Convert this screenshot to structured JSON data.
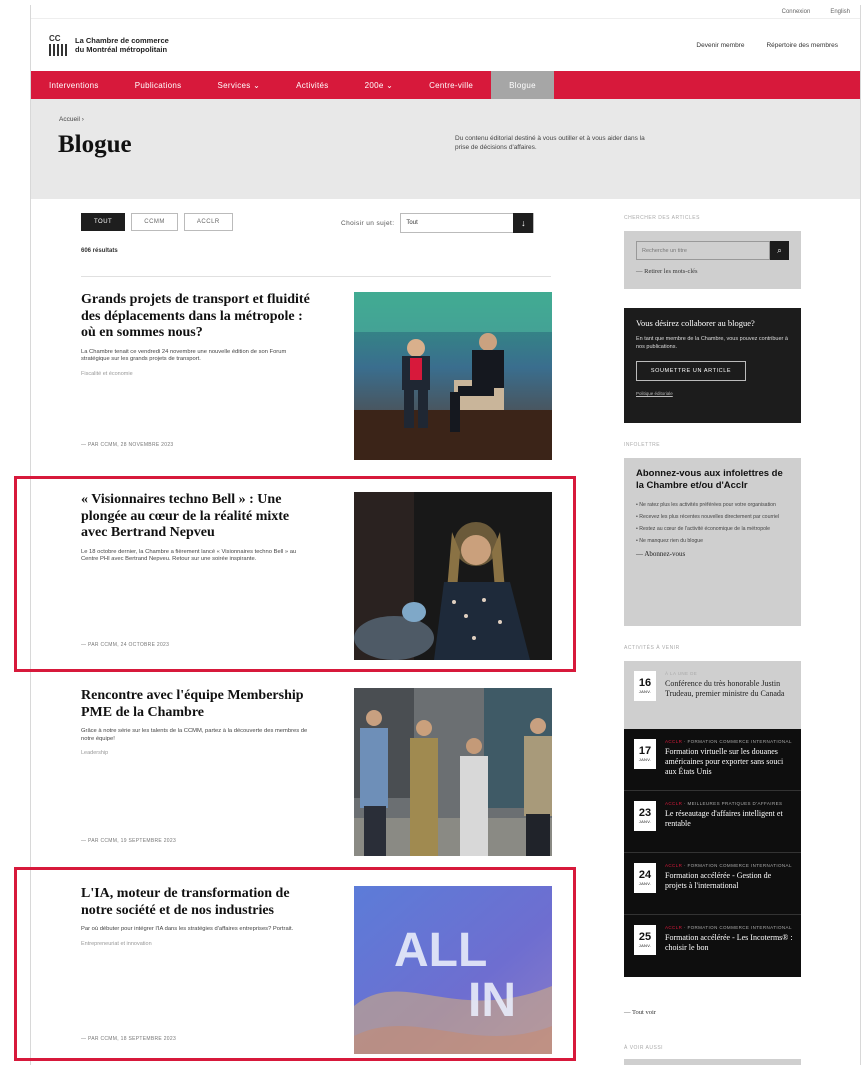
{
  "topbar": {
    "login": "Connexion",
    "lang": "English"
  },
  "header": {
    "logo_cc": "CC",
    "logo_line1": "La Chambre de commerce",
    "logo_line2": "du Montréal métropolitain",
    "link_member": "Devenir membre",
    "link_directory": "Répertoire des membres"
  },
  "nav": [
    {
      "label": "Interventions"
    },
    {
      "label": "Publications"
    },
    {
      "label": "Services ⌄"
    },
    {
      "label": "Activités"
    },
    {
      "label": "200e ⌄"
    },
    {
      "label": "Centre-ville"
    },
    {
      "label": "Blogue"
    }
  ],
  "page": {
    "breadcrumb": "Accueil  ›",
    "title": "Blogue",
    "description": "Du contenu éditorial destiné à vous outiller et à vous aider dans la prise de décisions d'affaires."
  },
  "filters": {
    "all": "TOUT",
    "ccmm": "CCMM",
    "acclr": "ACCLR"
  },
  "topic": {
    "label": "Choisir un sujet:",
    "value": "Tout",
    "arrow": "↓"
  },
  "results": "606 résultats",
  "articles": [
    {
      "title": "Grands projets de transport et fluidité des déplacements dans la métropole : où en sommes nous?",
      "excerpt": "La Chambre tenait ce vendredi 24 novembre une nouvelle édition de son Forum stratégique sur les grands projets de transport.",
      "tag": "Fiscalité et économie",
      "byline": "— PAR CCMM, 28 NOVEMBRE 2023"
    },
    {
      "title": "« Visionnaires techno Bell » : Une plongée au cœur de la réalité mixte avec Bertrand Nepveu",
      "excerpt": "Le 18 octobre dernier, la Chambre a fièrement lancé « Visionnaires techno Bell » au Centre PHI avec Bertrand Nepveu. Retour sur une soirée inspirante.",
      "tag": "",
      "byline": "— PAR CCMM, 24 OCTOBRE 2023"
    },
    {
      "title": "Rencontre avec l'équipe Membership PME de la Chambre",
      "excerpt": "Grâce à notre série sur les talents de la CCMM, partez à la découverte des membres de notre équipe!",
      "tag": "Leadership",
      "byline": "— PAR CCMM, 19 SEPTEMBRE 2023"
    },
    {
      "title": "L'IA, moteur de transformation de notre société et de nos industries",
      "excerpt": "Par où débuter pour intégrer l'IA dans les stratégies d'affaires entreprises? Portrait.",
      "tag": "Entrepreneuriat et innovation",
      "byline": "— PAR CCMM, 18 SEPTEMBRE 2023",
      "image_text_1": "ALL",
      "image_text_2": "IN"
    }
  ],
  "sidebar": {
    "search_label": "CHERCHER DES ARTICLES",
    "search_placeholder": "Recherche un titre",
    "search_reset": "Retirer les mots-clés",
    "collab_title": "Vous désirez collaborer au blogue?",
    "collab_text": "En tant que membre de la Chambre, vous pouvez contribuer à nos publications.",
    "collab_button": "SOUMETTRE UN ARTICLE",
    "collab_foot": "Politique éditoriale",
    "news_label": "INFOLETTRE",
    "news_title": "Abonnez-vous aux infolettres de la Chambre et/ou d'Acclr",
    "news_items": [
      "• Ne ratez plus les activités préférées pour votre organisation",
      "• Recevez les plus récentes nouvelles directement par courriel",
      "• Restez au cœur de l'activité économique de la métropole",
      "• Ne manquez rien du blogue"
    ],
    "news_link": "Abonnez-vous",
    "events_label": "ACTIVITÉS À VENIR",
    "events": [
      {
        "day": "16",
        "month": "JANV.",
        "cat_red": "",
        "cat": "À LA UNE DE",
        "title": "Conférence du très honorable Justin Trudeau, premier ministre du Canada"
      },
      {
        "day": "17",
        "month": "JANV.",
        "cat_red": "ACCLR",
        "cat": " · FORMATION COMMERCE INTERNATIONAL",
        "title": "Formation virtuelle sur les douanes américaines pour exporter sans souci aux États Unis"
      },
      {
        "day": "23",
        "month": "JANV.",
        "cat_red": "ACCLR",
        "cat": " · MEILLEURES PRATIQUES D'AFFAIRES",
        "title": "Le réseautage d'affaires intelligent et rentable"
      },
      {
        "day": "24",
        "month": "JANV.",
        "cat_red": "ACCLR",
        "cat": " · FORMATION COMMERCE INTERNATIONAL",
        "title": "Formation accélérée - Gestion de projets à l'international"
      },
      {
        "day": "25",
        "month": "JANV.",
        "cat_red": "ACCLR",
        "cat": " · FORMATION COMMERCE INTERNATIONAL",
        "title": "Formation accélérée - Les Incoterms® : choisir le bon"
      }
    ],
    "events_more": "Tout voir",
    "bottom_label": "À VOIR AUSSI"
  },
  "colors": {
    "brand_red": "#d7193b",
    "nav_active": "#a6a6a6",
    "dark": "#1c1c1c"
  }
}
